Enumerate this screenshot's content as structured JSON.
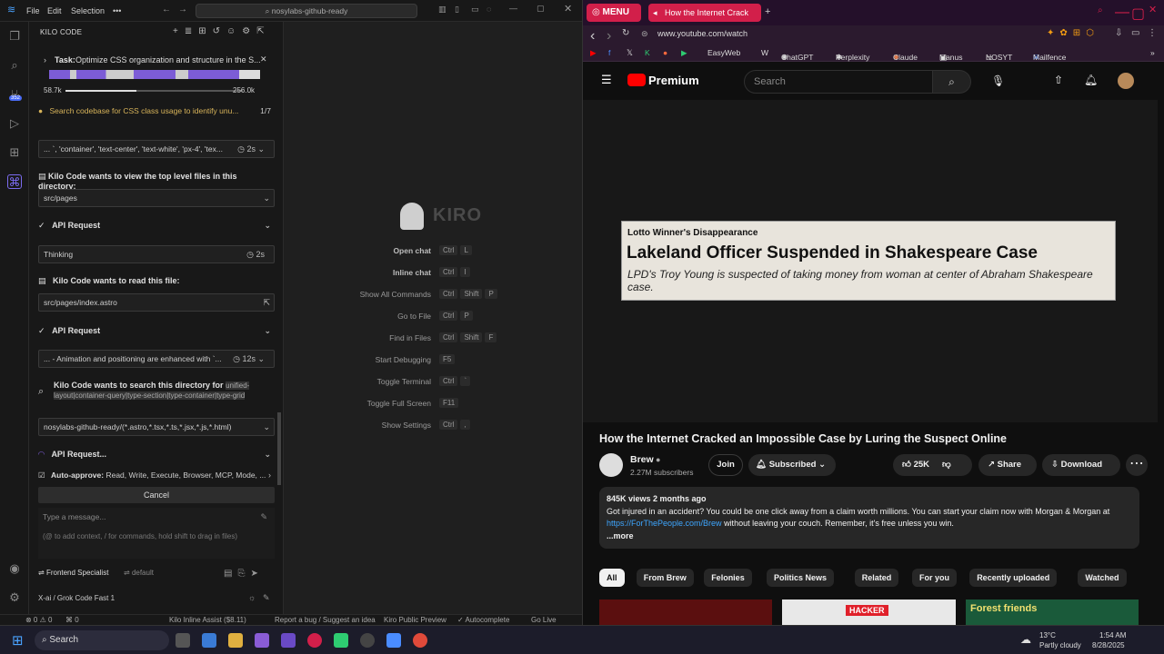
{
  "ide": {
    "menu": [
      "File",
      "Edit",
      "Selection",
      "•••"
    ],
    "search": "nosylabs-github-ready",
    "panel_title": "KILO CODE",
    "task": {
      "label": "Task:",
      "text": "Optimize CSS organization and structure in the S...",
      "tokens_left": "58.7k",
      "tokens_right": "256.0k"
    },
    "todo": {
      "text": "Search codebase for CSS class usage to identify unu...",
      "count": "1/7"
    },
    "items": [
      {
        "type": "box",
        "text": "... `, 'container', 'text-center', 'text-white', 'px-4', 'tex...",
        "meta": "2s"
      },
      {
        "type": "header",
        "text": "Kilo Code wants to view the top level files in this directory:"
      },
      {
        "type": "box",
        "text": "src/pages"
      },
      {
        "type": "header",
        "text": "API Request"
      },
      {
        "type": "box",
        "text": "Thinking",
        "meta": "2s"
      },
      {
        "type": "header",
        "text": "Kilo Code wants to read this file:"
      },
      {
        "type": "box",
        "text": "src/pages/index.astro"
      },
      {
        "type": "header",
        "text": "API Request"
      },
      {
        "type": "box",
        "text": "... - Animation and positioning are enhanced with `...",
        "meta": "12s"
      },
      {
        "type": "header",
        "text": "Kilo Code wants to search this directory for"
      },
      {
        "type": "code",
        "text": "unified-layout|container-query|type-section|type-container|type-grid"
      },
      {
        "type": "box",
        "text": "nosylabs-github-ready/(*.astro,*.tsx,*.ts,*.jsx,*.js,*.html)"
      },
      {
        "type": "header",
        "text": "API Request..."
      }
    ],
    "auto_approve": {
      "label": "Auto-approve:",
      "text": "Read, Write, Execute, Browser, MCP, Mode, ..."
    },
    "cancel": "Cancel",
    "input_placeholder": "Type a message...",
    "input_hint": "(@ to add context, / for commands, hold shift to drag in files)",
    "mode": "Frontend Specialist",
    "profile": "default",
    "model": "X-ai / Grok Code Fast 1",
    "logo_text": "KIRO",
    "shortcuts": [
      {
        "label": "Open chat",
        "keys": [
          "Ctrl",
          "L"
        ]
      },
      {
        "label": "Inline chat",
        "keys": [
          "Ctrl",
          "I"
        ]
      },
      {
        "label": "Show All Commands",
        "keys": [
          "Ctrl",
          "Shift",
          "P"
        ]
      },
      {
        "label": "Go to File",
        "keys": [
          "Ctrl",
          "P"
        ]
      },
      {
        "label": "Find in Files",
        "keys": [
          "Ctrl",
          "Shift",
          "F"
        ]
      },
      {
        "label": "Start Debugging",
        "keys": [
          "F5"
        ]
      },
      {
        "label": "Toggle Terminal",
        "keys": [
          "Ctrl",
          "`"
        ]
      },
      {
        "label": "Toggle Full Screen",
        "keys": [
          "F11"
        ]
      },
      {
        "label": "Show Settings",
        "keys": [
          "Ctrl",
          ","
        ]
      }
    ],
    "status": {
      "errors": "⊗ 0 ⚠ 0",
      "ports": "⌘ 0",
      "inline": "Kilo Inline Assist ($8.11)",
      "report": "Report a bug / Suggest an idea",
      "preview": "Kiro Public Preview",
      "autocomplete": "✓ Autocomplete",
      "golive": "Go Live"
    },
    "badge": "352"
  },
  "browser": {
    "menu": "MENU",
    "tab_title": "How the Internet Crack",
    "url": "www.youtube.com/watch",
    "bookmarks": [
      "EasyWeb",
      "ChatGPT",
      "Perplexity",
      "Claude",
      "Manus",
      "NOSYT",
      "Mailfence"
    ],
    "yt_logo": "Premium",
    "search_placeholder": "Search",
    "lower_third": {
      "kicker": "Lotto Winner's Disappearance",
      "headline": "Lakeland Officer Suspended in Shakespeare Case",
      "sub": "LPD's Troy Young is suspected of taking money from woman at center of Abraham Shakespeare case."
    },
    "video_title": "How the Internet Cracked an Impossible Case by Luring the Suspect Online",
    "channel": {
      "name": "Brew",
      "subs": "2.27M subscribers"
    },
    "join": "Join",
    "subscribed": "Subscribed",
    "likes": "25K",
    "share": "Share",
    "download": "Download",
    "description": {
      "stats": "845K views  2 months ago",
      "line1": "Got injured in an accident? You could be one click away from a claim worth millions. You can start your claim now with Morgan & Morgan at",
      "link": "https://ForThePeople.com/Brew",
      "line2": " without leaving your couch. Remember, it's free unless you win.",
      "more": "...more"
    },
    "chips": [
      "All",
      "From Brew",
      "Felonies",
      "Politics News",
      "Related",
      "For you",
      "Recently uploaded",
      "Watched"
    ],
    "thumb_labels": [
      "HACKER",
      "Forest friends"
    ]
  },
  "taskbar": {
    "search": "Search",
    "weather_temp": "13°C",
    "weather_desc": "Partly cloudy",
    "time": "1:54 AM",
    "date": "8/28/2025"
  }
}
